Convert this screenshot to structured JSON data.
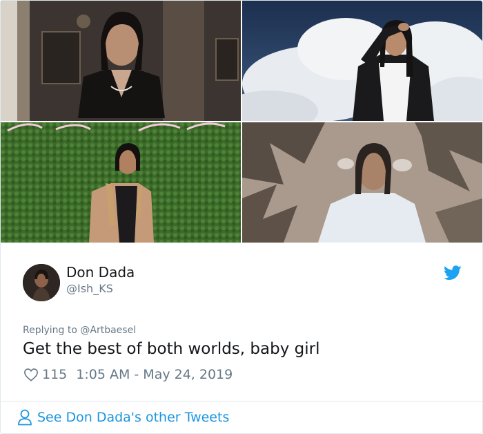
{
  "media": {
    "photos": [
      {
        "icon": "photo-woman-dark-room"
      },
      {
        "icon": "photo-woman-sky-clouds"
      },
      {
        "icon": "photo-woman-green-wall"
      },
      {
        "icon": "photo-woman-palm-shadows"
      }
    ]
  },
  "author": {
    "name": "Don Dada",
    "handle": "@Ish_KS"
  },
  "tweet": {
    "replying_prefix": "Replying to",
    "replying_to": "@Artbaesel",
    "text": "Get the best of both worlds, baby girl",
    "likes": "115",
    "timestamp": "1:05 AM - May 24, 2019"
  },
  "footer": {
    "other_tweets_label": "See Don Dada's other Tweets"
  },
  "colors": {
    "link": "#1b95e0",
    "twitter_blue": "#1da1f2",
    "muted": "#657786",
    "text": "#14171a",
    "border": "#e1e8ed"
  }
}
